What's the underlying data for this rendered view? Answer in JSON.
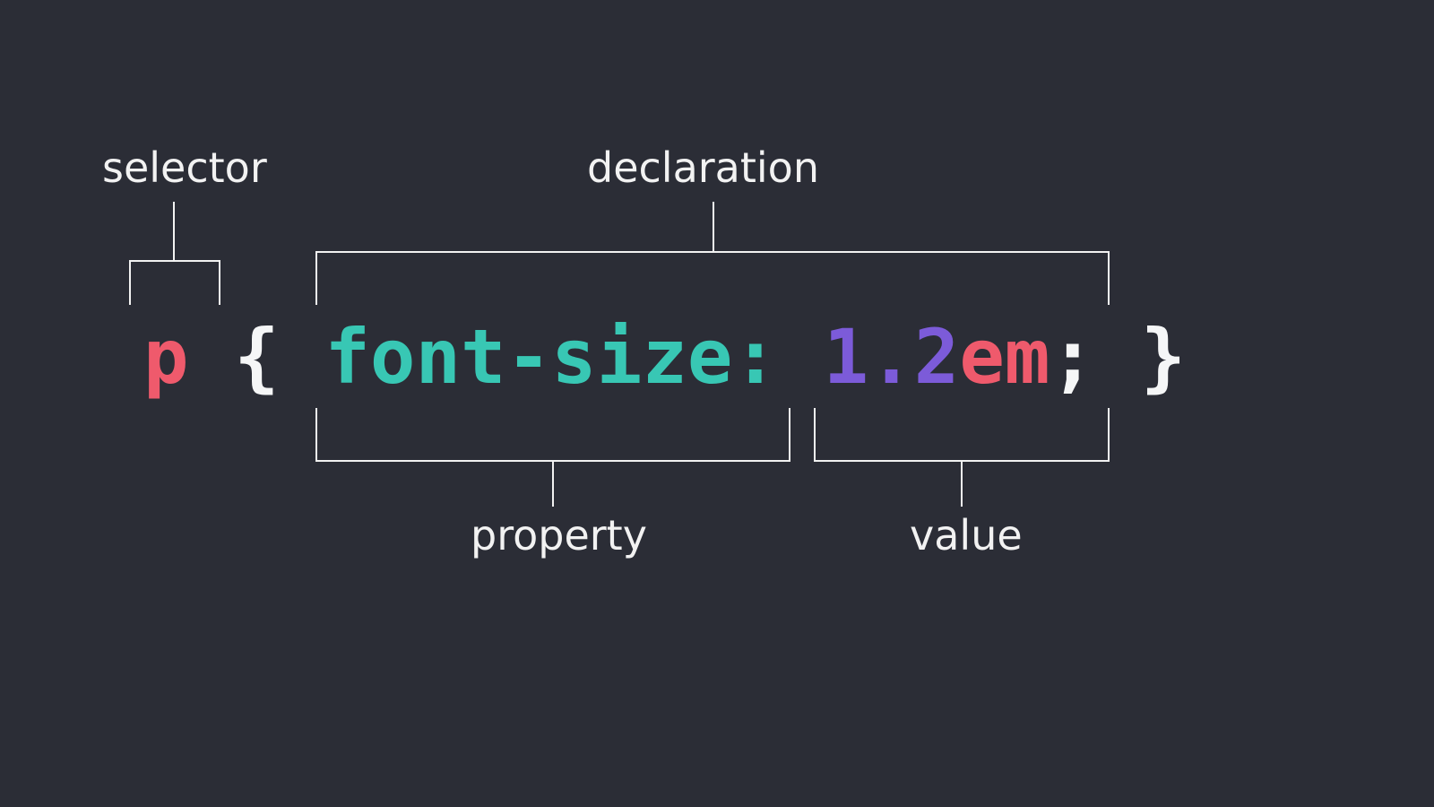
{
  "labels": {
    "selector": "selector",
    "declaration": "declaration",
    "property": "property",
    "value": "value"
  },
  "code": {
    "selector": "p",
    "space1": " ",
    "brace_open": "{",
    "space2": " ",
    "property": "font-size",
    "colon": ":",
    "space3": " ",
    "number": "1.2",
    "unit": "em",
    "semi": ";",
    "space4": " ",
    "brace_close": "}"
  }
}
